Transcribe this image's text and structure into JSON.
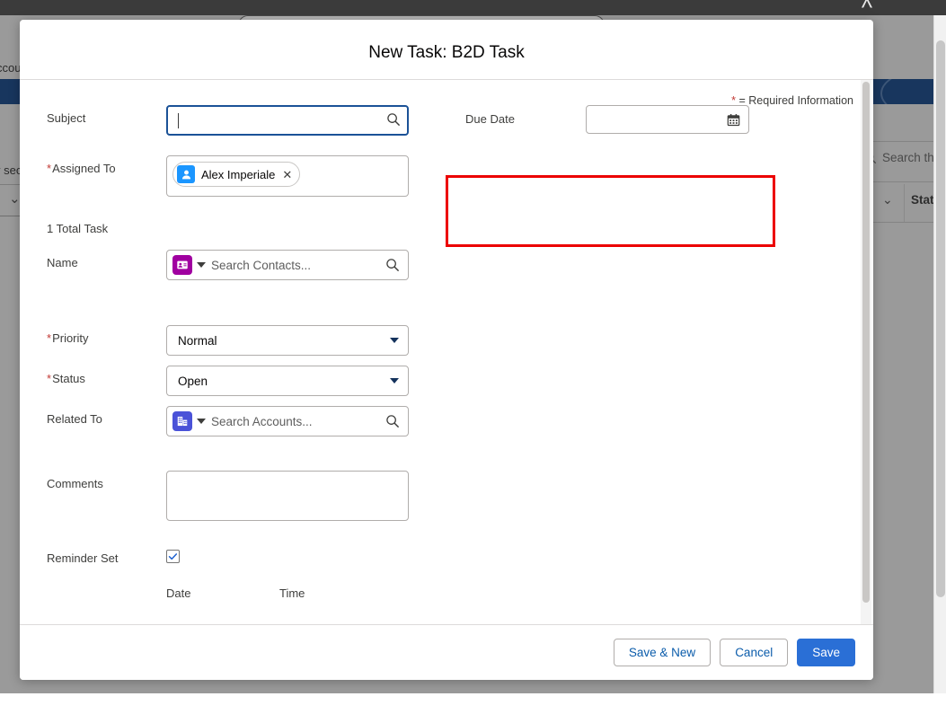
{
  "background": {
    "topbar_chevron_icon": "chevron-up-icon",
    "text_fragment_left_top": "ccou",
    "text_fragment_left_mid": "v sec",
    "search_placeholder_fragment": "Search thi",
    "column_header_status": "Status",
    "search_icon": "search-icon",
    "chevron_icon": "chevron-down-icon"
  },
  "modal": {
    "title": "New Task: B2D Task",
    "required_note_star": "*",
    "required_note_text": "= Required Information",
    "total_task_text": "1 Total Task",
    "fields": {
      "subject": {
        "label": "Subject",
        "value": "",
        "placeholder": "",
        "icon": "search-icon",
        "focused": true
      },
      "assigned_to": {
        "label": "Assigned To",
        "required": true,
        "pill_label": "Alex Imperiale",
        "pill_avatar_icon": "user-icon",
        "pill_remove_icon": "close-icon"
      },
      "name": {
        "label": "Name",
        "placeholder": "Search Contacts...",
        "object_icon": "contact-icon",
        "object_icon_color": "#a000a0",
        "dropdown_icon": "chevron-down-icon",
        "search_icon": "search-icon"
      },
      "priority": {
        "label": "Priority",
        "required": true,
        "value": "Normal",
        "dropdown_icon": "chevron-down-icon"
      },
      "status": {
        "label": "Status",
        "required": true,
        "value": "Open",
        "dropdown_icon": "chevron-down-icon"
      },
      "related_to": {
        "label": "Related To",
        "placeholder": "Search Accounts...",
        "object_icon": "account-icon",
        "object_icon_color": "#4a52d8",
        "dropdown_icon": "chevron-down-icon",
        "search_icon": "search-icon"
      },
      "comments": {
        "label": "Comments",
        "value": "",
        "placeholder": ""
      },
      "reminder_set": {
        "label": "Reminder Set",
        "checked": true,
        "check_icon": "checkmark-icon"
      },
      "reminder_date_label": "Date",
      "reminder_time_label": "Time",
      "due_date": {
        "label": "Due Date",
        "value": "",
        "placeholder": "",
        "calendar_icon": "calendar-icon",
        "highlighted": true,
        "highlight_color": "#ec0000"
      }
    },
    "footer": {
      "save_and_new_label": "Save & New",
      "cancel_label": "Cancel",
      "save_label": "Save"
    }
  },
  "colors": {
    "brand_blue": "#2a6fd6",
    "link_blue": "#0b5cab",
    "required_red": "#c23934",
    "highlight_red": "#ec0000",
    "focus_border": "#1b5297"
  }
}
